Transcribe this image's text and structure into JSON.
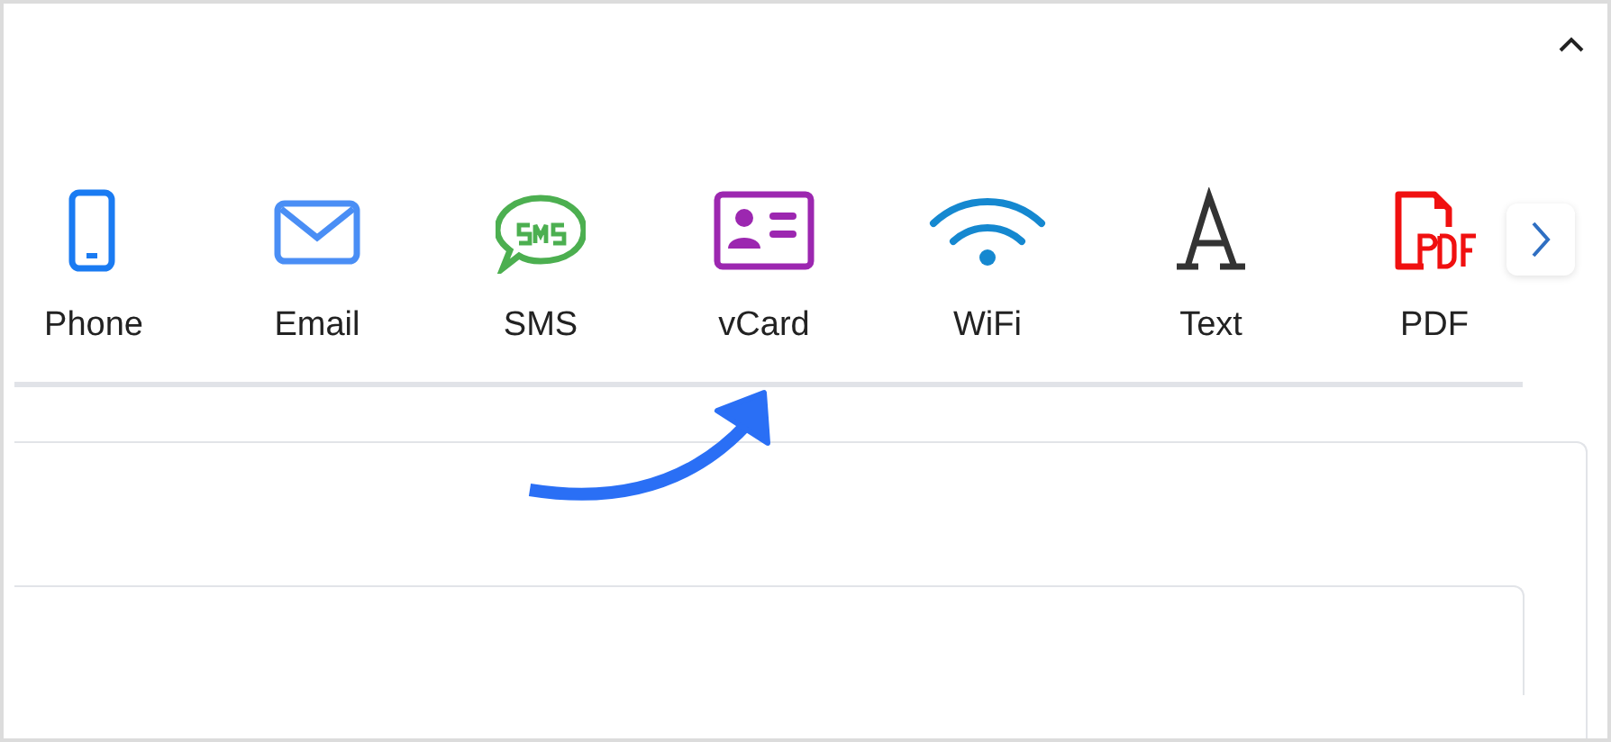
{
  "tabs": [
    {
      "label": "Phone",
      "kind": "phone"
    },
    {
      "label": "Email",
      "kind": "email"
    },
    {
      "label": "SMS",
      "kind": "sms"
    },
    {
      "label": "vCard",
      "kind": "vcard"
    },
    {
      "label": "WiFi",
      "kind": "wifi"
    },
    {
      "label": "Text",
      "kind": "text"
    },
    {
      "label": "PDF",
      "kind": "pdf"
    }
  ]
}
